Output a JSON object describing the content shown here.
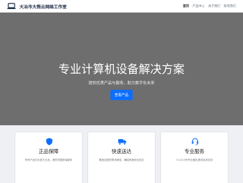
{
  "navbar": {
    "brand": "大冶市大熊云网络工作室",
    "links": [
      "首页",
      "产品中心",
      "关于我们",
      "联系我们"
    ],
    "active_index": 0
  },
  "hero": {
    "title": "专业计算机设备解决方案",
    "subtitle": "提供优质产品与服务，助力数字化未来",
    "button": "查看产品"
  },
  "features": [
    {
      "icon": "shield-icon",
      "title": "正品保障",
      "desc": "所有产品均为官方正品，提供完整质保服务"
    },
    {
      "icon": "truck-icon",
      "title": "快速送达",
      "desc": "覆盖全国的物流网络，确保快速安全送达"
    },
    {
      "icon": "headset-icon",
      "title": "专业服务",
      "desc": "7×24小时专业团队提供技术支持"
    }
  ],
  "colors": {
    "primary": "#0d6efd",
    "hero_bg": "#6e6e6e",
    "brand_text": "#1a2a44"
  }
}
